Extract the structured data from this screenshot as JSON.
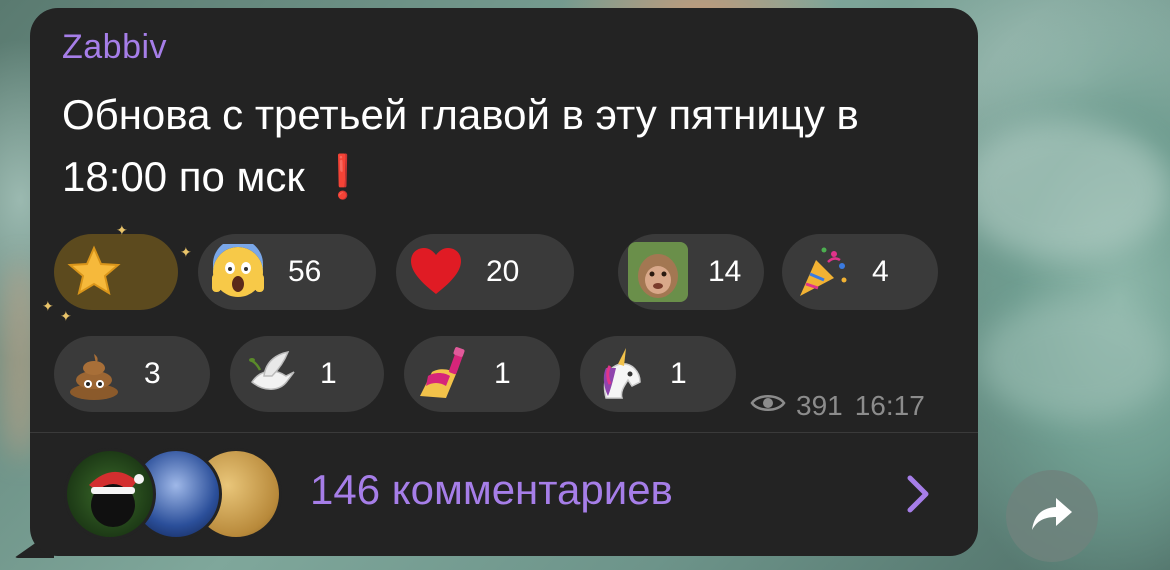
{
  "message": {
    "author": "Zabbiv",
    "text": "Обнова с третьей главой в эту пятницу в 18:00 по мск",
    "text_emoji": "❗"
  },
  "reactions": [
    {
      "icon": "star-icon",
      "count": ""
    },
    {
      "icon": "screaming-face-icon",
      "count": "56"
    },
    {
      "icon": "heart-icon",
      "count": "20"
    },
    {
      "icon": "monkey-photo-icon",
      "count": "14"
    },
    {
      "icon": "party-popper-icon",
      "count": "4"
    },
    {
      "icon": "poop-icon",
      "count": "3"
    },
    {
      "icon": "dove-icon",
      "count": "1"
    },
    {
      "icon": "nail-polish-icon",
      "count": "1"
    },
    {
      "icon": "unicorn-icon",
      "count": "1"
    }
  ],
  "meta": {
    "views": "391",
    "time": "16:17"
  },
  "comments": {
    "label": "146 комментариев"
  },
  "colors": {
    "bubble": "#232323",
    "accent": "#a67ee8",
    "reaction_bg": "#3a3a3a",
    "meta_text": "#8c8c8c"
  }
}
